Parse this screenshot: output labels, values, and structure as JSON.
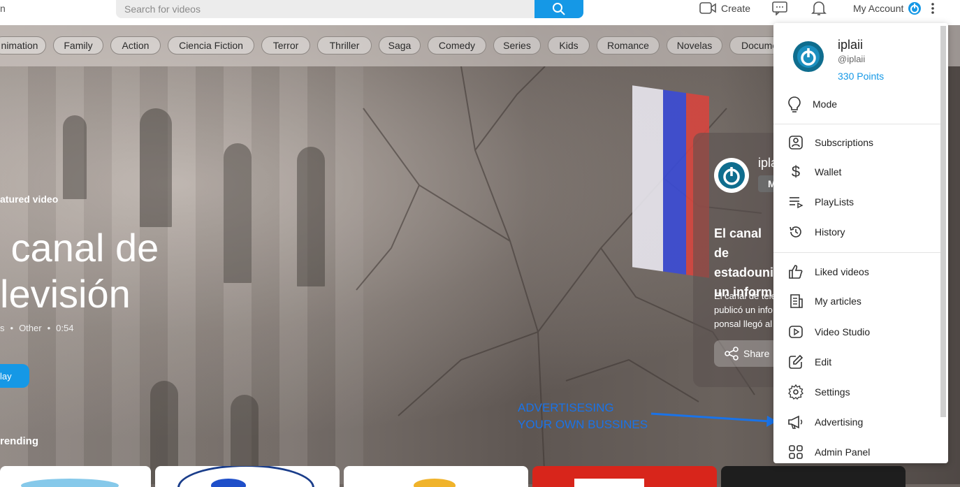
{
  "topbar": {
    "logo_fragment": "n",
    "search_placeholder": "Search for videos",
    "create_label": "Create",
    "account_label": "My Account"
  },
  "categories": [
    "nimation",
    "Family",
    "Action",
    "Ciencia Fiction",
    "Terror",
    "Thriller",
    "Saga",
    "Comedy",
    "Series",
    "Kids",
    "Romance",
    "Novelas",
    "Docume"
  ],
  "featured": {
    "label": "atured video",
    "title": " canal de\nlevisión",
    "meta": [
      "s",
      "Other",
      "0:54"
    ],
    "play_label": "lay"
  },
  "trending_label": "rending",
  "card": {
    "channel": "ipla",
    "badge": "M",
    "title_lines": [
      "El canal de",
      "estadouni",
      "un inform"
    ],
    "desc_lines": [
      "El canal de tele",
      "publicó un info",
      "ponsal llegó al"
    ],
    "share_label": "Share"
  },
  "annotation": {
    "line1": "ADVERTISESING",
    "line2": "YOUR OWN BUSSINES"
  },
  "account_menu": {
    "username": "iplaii",
    "handle": "@iplaii",
    "points": "330 Points",
    "mode_label": "Mode",
    "items": [
      {
        "label": "Subscriptions",
        "icon": "subscriptions-icon"
      },
      {
        "label": "Wallet",
        "icon": "dollar-icon"
      },
      {
        "label": "PlayLists",
        "icon": "playlist-icon"
      },
      {
        "label": "History",
        "icon": "history-icon"
      },
      {
        "label": "Liked videos",
        "icon": "thumbs-up-icon"
      },
      {
        "label": "My articles",
        "icon": "articles-icon"
      },
      {
        "label": "Video Studio",
        "icon": "video-studio-icon"
      },
      {
        "label": "Edit",
        "icon": "edit-icon"
      },
      {
        "label": "Settings",
        "icon": "gear-icon"
      },
      {
        "label": "Advertising",
        "icon": "megaphone-icon"
      },
      {
        "label": "Admin Panel",
        "icon": "grid-icon"
      }
    ]
  },
  "colors": {
    "accent": "#1598e6",
    "annotation": "#1a73e8"
  }
}
